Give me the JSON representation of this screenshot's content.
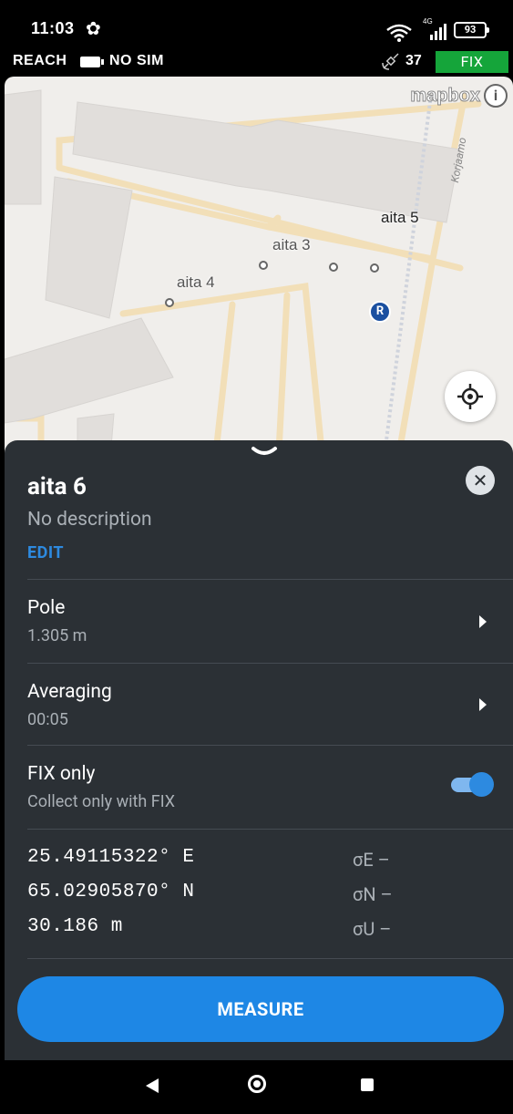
{
  "status": {
    "time": "11:03",
    "network": "4G",
    "battery": "93"
  },
  "reach_bar": {
    "device": "REACH",
    "sim": "NO SIM",
    "satellites": "37",
    "solution": "FIX"
  },
  "map": {
    "attribution": "mapbox",
    "street": "Korjaamo",
    "points": [
      "aita 5",
      "aita 3",
      "aita 4"
    ],
    "base_marker": "R"
  },
  "point_sheet": {
    "title": "aita 6",
    "description": "No description",
    "edit_label": "EDIT",
    "pole": {
      "label": "Pole",
      "value": "1.305 m"
    },
    "averaging": {
      "label": "Averaging",
      "value": "00:05"
    },
    "fix_only": {
      "label": "FIX only",
      "hint": "Collect only with FIX",
      "enabled": true
    },
    "coordinates": [
      {
        "value": "25.49115322° E",
        "sigma": "σE –"
      },
      {
        "value": "65.02905870° N",
        "sigma": "σN –"
      },
      {
        "value": "30.186 m",
        "sigma": "σU –"
      }
    ],
    "measure_label": "MEASURE"
  },
  "colors": {
    "accent": "#1e87e5",
    "fix_green": "#15a53a",
    "sheet_bg": "#2b3035"
  }
}
